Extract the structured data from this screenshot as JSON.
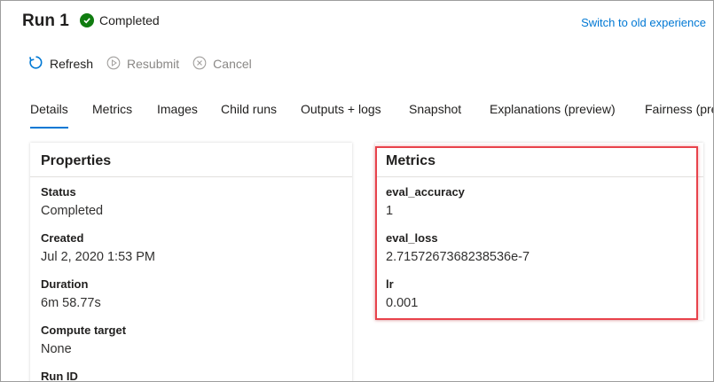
{
  "header": {
    "title": "Run 1",
    "status": "Completed",
    "switch_link": "Switch to old experience"
  },
  "toolbar": {
    "refresh_label": "Refresh",
    "resubmit_label": "Resubmit",
    "cancel_label": "Cancel"
  },
  "tabs": [
    {
      "label": "Details",
      "active": true
    },
    {
      "label": "Metrics"
    },
    {
      "label": "Images"
    },
    {
      "label": "Child runs"
    },
    {
      "label": "Outputs + logs"
    },
    {
      "label": "Snapshot"
    },
    {
      "label": "Explanations (preview)"
    },
    {
      "label": "Fairness (preview)"
    }
  ],
  "properties": {
    "title": "Properties",
    "fields": [
      {
        "label": "Status",
        "value": "Completed"
      },
      {
        "label": "Created",
        "value": "Jul 2, 2020 1:53 PM"
      },
      {
        "label": "Duration",
        "value": "6m 58.77s"
      },
      {
        "label": "Compute target",
        "value": "None"
      },
      {
        "label": "Run ID",
        "value": ""
      }
    ]
  },
  "metrics": {
    "title": "Metrics",
    "fields": [
      {
        "label": "eval_accuracy",
        "value": "1"
      },
      {
        "label": "eval_loss",
        "value": "2.7157267368238536e-7"
      },
      {
        "label": "lr",
        "value": "0.001"
      }
    ]
  },
  "colors": {
    "accent": "#0078d4",
    "success": "#107c10",
    "highlight": "#e8424b"
  }
}
